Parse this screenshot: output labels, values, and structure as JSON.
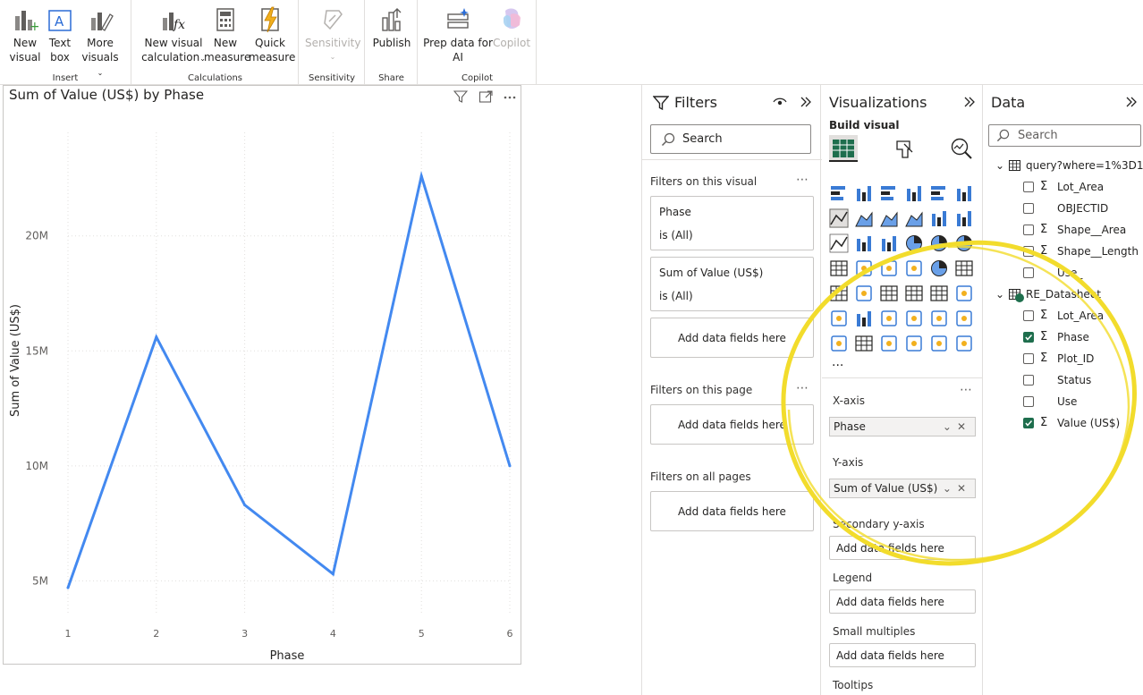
{
  "ribbon": {
    "groups": [
      {
        "caption": "Insert",
        "buttons": [
          {
            "line1": "New",
            "line2": "visual",
            "icon": "new-visual-icon"
          },
          {
            "line1": "Text",
            "line2": "box",
            "icon": "text-box-icon"
          },
          {
            "line1": "More",
            "line2": "visuals",
            "icon": "more-visuals-icon"
          }
        ]
      },
      {
        "caption": "Calculations",
        "buttons": [
          {
            "line1": "New visual",
            "line2": "calculation",
            "icon": "visual-calculation-icon"
          },
          {
            "line1": "New",
            "line2": "measure",
            "icon": "calculator-icon"
          },
          {
            "line1": "Quick",
            "line2": "measure",
            "icon": "quick-measure-icon"
          }
        ]
      },
      {
        "caption": "Sensitivity",
        "buttons": [
          {
            "line1": "Sensitivity",
            "line2": "",
            "icon": "sensitivity-icon"
          }
        ]
      },
      {
        "caption": "Share",
        "buttons": [
          {
            "line1": "Publish",
            "line2": "",
            "icon": "publish-icon"
          }
        ]
      },
      {
        "caption": "Copilot",
        "buttons": [
          {
            "line1": "Prep data for",
            "line2": "AI",
            "icon": "prep-data-icon"
          },
          {
            "line1": "Copilot",
            "line2": "",
            "icon": "copilot-icon"
          }
        ]
      }
    ]
  },
  "chart_data": {
    "type": "line",
    "title": "Sum of Value (US$) by Phase",
    "xlabel": "Phase",
    "ylabel": "Sum of Value (US$)",
    "x": [
      1,
      2,
      3,
      4,
      5,
      6
    ],
    "y_ticks": [
      "5M",
      "10M",
      "15M",
      "20M"
    ],
    "y_tick_values": [
      5000000,
      10000000,
      15000000,
      20000000
    ],
    "ylim": [
      3500000,
      24500000
    ],
    "series": [
      {
        "values": [
          4700000,
          15600000,
          8300000,
          5300000,
          22600000,
          10000000
        ],
        "color": "#4389f0"
      }
    ],
    "grid": true
  },
  "filters": {
    "title": "Filters",
    "search_placeholder": "Search",
    "on_visual_label": "Filters on this visual",
    "cards": [
      {
        "field": "Phase",
        "state": "is (All)"
      },
      {
        "field": "Sum of Value (US$)",
        "state": "is (All)"
      }
    ],
    "add_fields": "Add data fields here",
    "on_page_label": "Filters on this page",
    "all_pages_label": "Filters on all pages"
  },
  "visualizations": {
    "title": "Visualizations",
    "build_label": "Build visual",
    "more": "...",
    "wells": {
      "xaxis_label": "X-axis",
      "xaxis_value": "Phase",
      "yaxis_label": "Y-axis",
      "yaxis_value": "Sum of Value (US$)",
      "secondary_label": "Secondary y-axis",
      "legend_label": "Legend",
      "small_multiples_label": "Small multiples",
      "tooltips_label": "Tooltips",
      "add_fields": "Add data fields here"
    }
  },
  "data": {
    "title": "Data",
    "search_placeholder": "Search",
    "tables": [
      {
        "name": "query?where=1%3D1...",
        "fields": [
          {
            "name": "Lot_Area",
            "sigma": true,
            "checked": false
          },
          {
            "name": "OBJECTID",
            "sigma": false,
            "checked": false
          },
          {
            "name": "Shape__Area",
            "sigma": true,
            "checked": false
          },
          {
            "name": "Shape__Length",
            "sigma": true,
            "checked": false
          },
          {
            "name": "Use_",
            "sigma": false,
            "checked": false
          }
        ]
      },
      {
        "name": "RE_Datasheet",
        "fields": [
          {
            "name": "Lot_Area",
            "sigma": true,
            "checked": false
          },
          {
            "name": "Phase",
            "sigma": true,
            "checked": true
          },
          {
            "name": "Plot_ID",
            "sigma": true,
            "checked": false
          },
          {
            "name": "Status",
            "sigma": false,
            "checked": false
          },
          {
            "name": "Use",
            "sigma": false,
            "checked": false
          },
          {
            "name": "Value (US$)",
            "sigma": true,
            "checked": true
          }
        ]
      }
    ]
  },
  "colors": {
    "accent": "#4389f0",
    "highlight": "#f2dc2c",
    "checked": "#1e6e4d"
  }
}
